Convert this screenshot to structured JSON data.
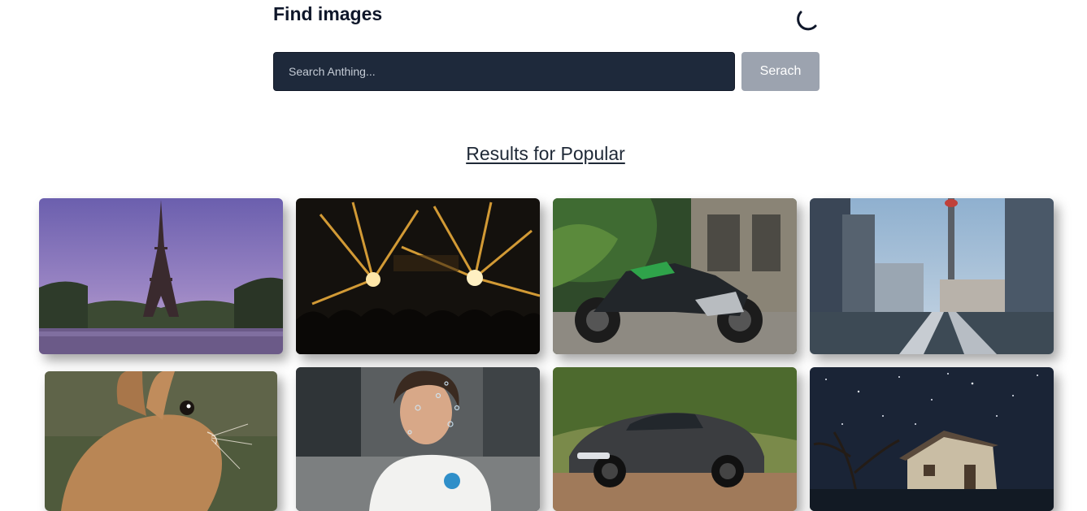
{
  "header": {
    "title": "Find images",
    "theme_icon": "moon-icon"
  },
  "search": {
    "placeholder": "Search Anthing...",
    "value": "",
    "button_label": "Serach"
  },
  "results": {
    "heading": "Results for Popular",
    "images": [
      {
        "subject": "eiffel-tower"
      },
      {
        "subject": "concert-lights"
      },
      {
        "subject": "motorcycle"
      },
      {
        "subject": "city-tower"
      },
      {
        "subject": "rabbit"
      },
      {
        "subject": "woman-bubbles"
      },
      {
        "subject": "sports-car"
      },
      {
        "subject": "starry-house"
      }
    ]
  },
  "colors": {
    "input_bg": "#1e293b",
    "button_bg": "#9ca3af",
    "text": "#0f172a"
  }
}
